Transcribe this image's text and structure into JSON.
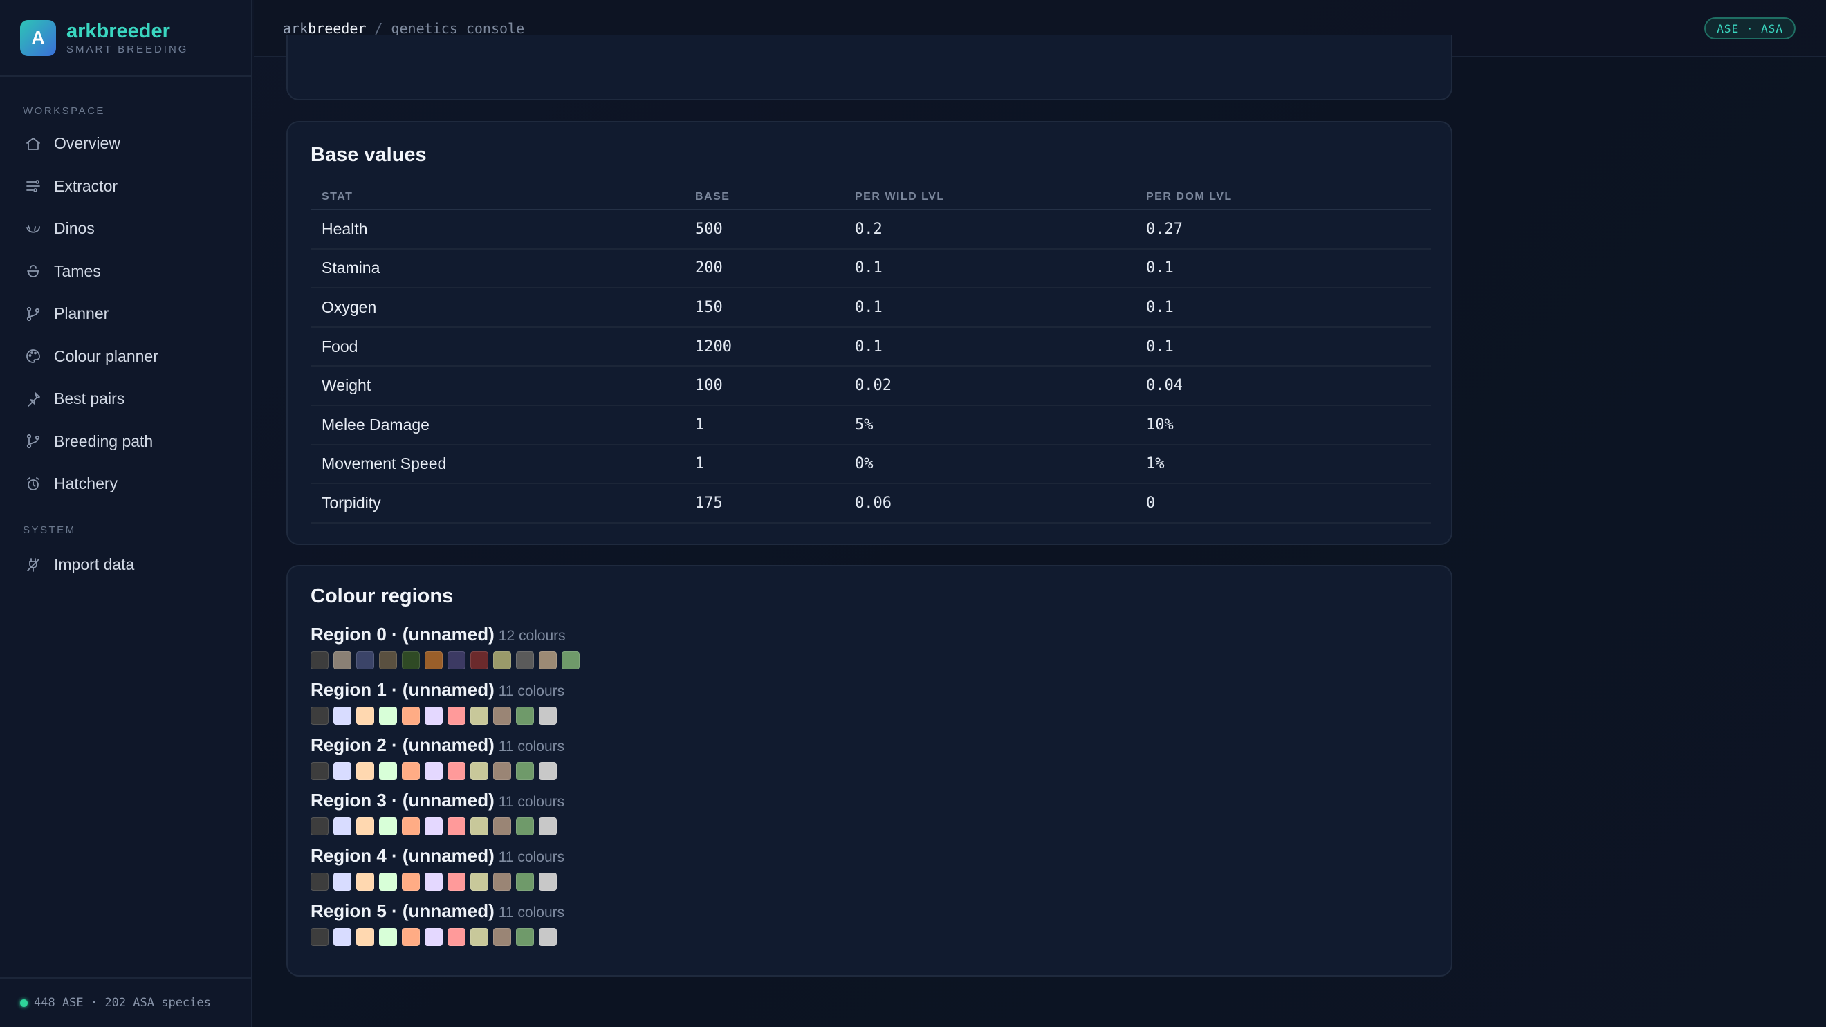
{
  "brand": {
    "logo_letter": "A",
    "name_part1": "ark",
    "name_part2": "breeder",
    "subtitle": "SMART BREEDING"
  },
  "sidebar": {
    "workspace_label": "WORKSPACE",
    "workspace_items": [
      {
        "label": "Overview",
        "icon": "home-icon"
      },
      {
        "label": "Extractor",
        "icon": "extractor-icon"
      },
      {
        "label": "Dinos",
        "icon": "dino-icon"
      },
      {
        "label": "Tames",
        "icon": "tame-icon"
      },
      {
        "label": "Planner",
        "icon": "branch-icon"
      },
      {
        "label": "Colour planner",
        "icon": "palette-icon"
      },
      {
        "label": "Best pairs",
        "icon": "pin-icon"
      },
      {
        "label": "Breeding path",
        "icon": "branch-icon"
      },
      {
        "label": "Hatchery",
        "icon": "alarm-clock-icon"
      }
    ],
    "system_label": "SYSTEM",
    "system_items": [
      {
        "label": "Import data",
        "icon": "plug-icon"
      }
    ],
    "footer_status": "448 ASE · 202 ASA species"
  },
  "topbar": {
    "crumb_app_prefix": "ark",
    "crumb_app_bold": "breeder",
    "crumb_sep": "/",
    "crumb_page": "genetics console",
    "badge": "ASE · ASA"
  },
  "base_values": {
    "title": "Base values",
    "headers": [
      "STAT",
      "BASE",
      "PER WILD LVL",
      "PER DOM LVL"
    ],
    "rows": [
      {
        "stat": "Health",
        "base": "500",
        "wild": "0.2",
        "dom": "0.27"
      },
      {
        "stat": "Stamina",
        "base": "200",
        "wild": "0.1",
        "dom": "0.1"
      },
      {
        "stat": "Oxygen",
        "base": "150",
        "wild": "0.1",
        "dom": "0.1"
      },
      {
        "stat": "Food",
        "base": "1200",
        "wild": "0.1",
        "dom": "0.1"
      },
      {
        "stat": "Weight",
        "base": "100",
        "wild": "0.02",
        "dom": "0.04"
      },
      {
        "stat": "Melee Damage",
        "base": "1",
        "wild": "5%",
        "dom": "10%"
      },
      {
        "stat": "Movement Speed",
        "base": "1",
        "wild": "0%",
        "dom": "1%"
      },
      {
        "stat": "Torpidity",
        "base": "175",
        "wild": "0.06",
        "dom": "0"
      }
    ]
  },
  "colour_regions": {
    "title": "Colour regions",
    "regions": [
      {
        "name": "Region 0 · (unnamed)",
        "count": "12 colours",
        "colors": [
          "#3d3d3d",
          "#8a8075",
          "#3b4468",
          "#5a5040",
          "#2f4a25",
          "#9a5f2a",
          "#3c3a63",
          "#6b2a2c",
          "#9a9a6a",
          "#5a5a5a",
          "#9c8a75",
          "#6f9a6a"
        ]
      },
      {
        "name": "Region 1 · (unnamed)",
        "count": "11 colours",
        "colors": [
          "#3d3d3d",
          "#d8dcff",
          "#ffd8b0",
          "#d8ffd8",
          "#ffac85",
          "#e4d8ff",
          "#ff9a9a",
          "#c8c89a",
          "#9a8575",
          "#6f9a6a",
          "#c8c8c8"
        ]
      },
      {
        "name": "Region 2 · (unnamed)",
        "count": "11 colours",
        "colors": [
          "#3d3d3d",
          "#d8dcff",
          "#ffd8b0",
          "#d8ffd8",
          "#ffac85",
          "#e4d8ff",
          "#ff9a9a",
          "#c8c89a",
          "#9a8575",
          "#6f9a6a",
          "#c8c8c8"
        ]
      },
      {
        "name": "Region 3 · (unnamed)",
        "count": "11 colours",
        "colors": [
          "#3d3d3d",
          "#d8dcff",
          "#ffd8b0",
          "#d8ffd8",
          "#ffac85",
          "#e4d8ff",
          "#ff9a9a",
          "#c8c89a",
          "#9a8575",
          "#6f9a6a",
          "#c8c8c8"
        ]
      },
      {
        "name": "Region 4 · (unnamed)",
        "count": "11 colours",
        "colors": [
          "#3d3d3d",
          "#d8dcff",
          "#ffd8b0",
          "#d8ffd8",
          "#ffac85",
          "#e4d8ff",
          "#ff9a9a",
          "#c8c89a",
          "#9a8575",
          "#6f9a6a",
          "#c8c8c8"
        ]
      },
      {
        "name": "Region 5 · (unnamed)",
        "count": "11 colours",
        "colors": [
          "#3d3d3d",
          "#d8dcff",
          "#ffd8b0",
          "#d8ffd8",
          "#ffac85",
          "#e4d8ff",
          "#ff9a9a",
          "#c8c89a",
          "#9a8575",
          "#6f9a6a",
          "#c8c8c8"
        ]
      }
    ]
  },
  "theme": {
    "accent": "#3ad6c0",
    "status_ok": "#2fd59a"
  }
}
